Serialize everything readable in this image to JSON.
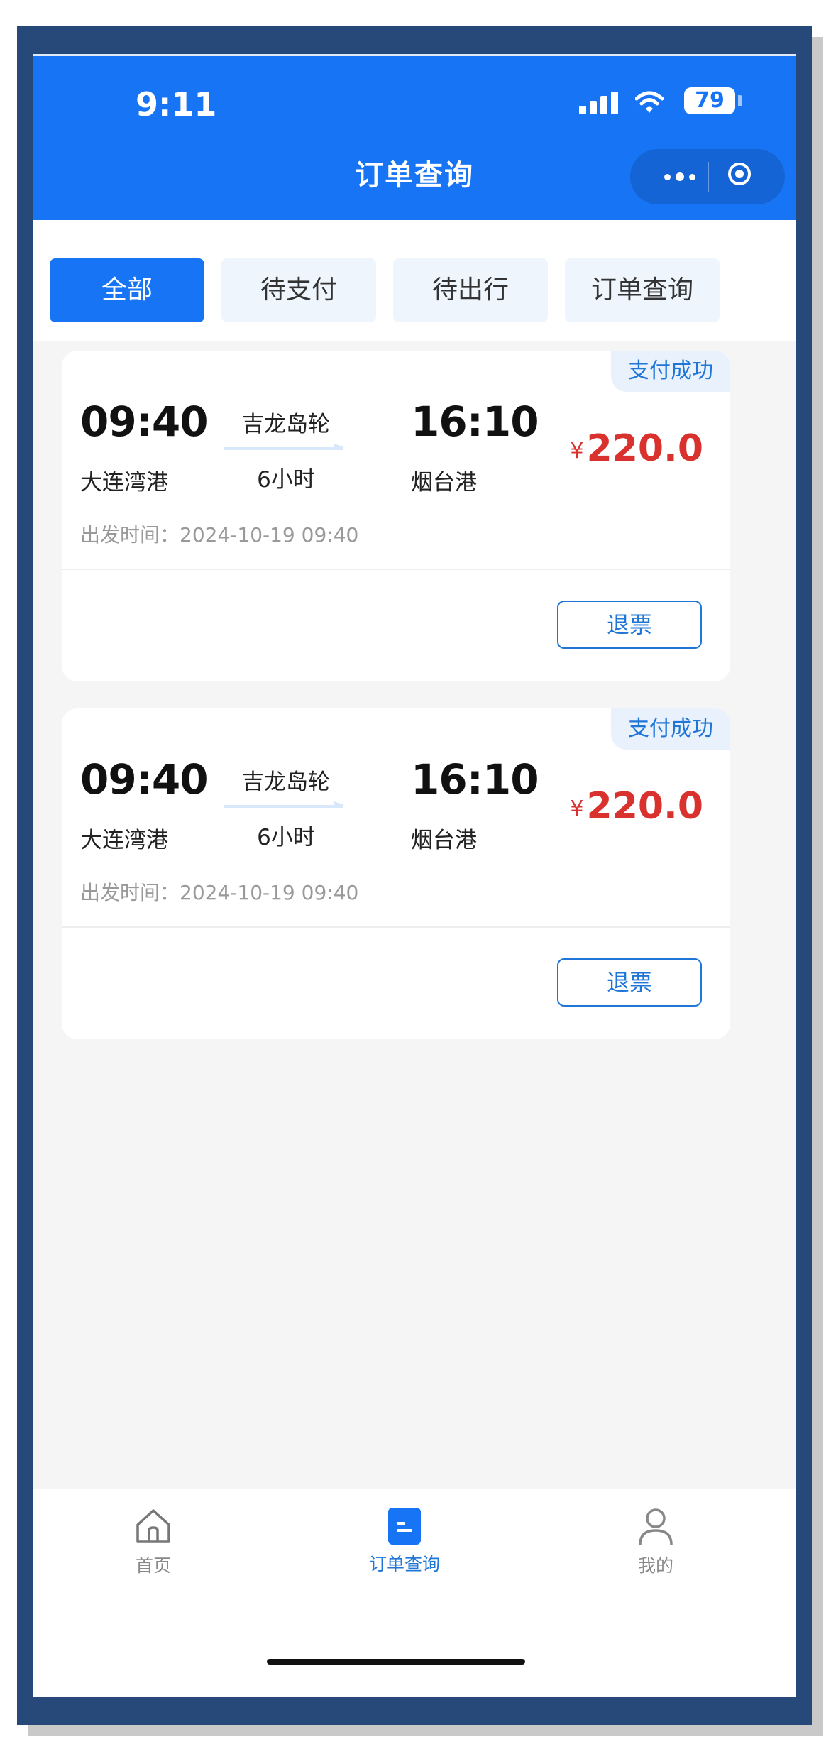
{
  "status_bar": {
    "time": "9:11",
    "battery": "79"
  },
  "header": {
    "title": "订单查询"
  },
  "tabs": [
    {
      "label": "全部",
      "active": true
    },
    {
      "label": "待支付",
      "active": false
    },
    {
      "label": "待出行",
      "active": false
    },
    {
      "label": "订单查询",
      "active": false
    }
  ],
  "orders": [
    {
      "status": "支付成功",
      "depart_time": "09:40",
      "depart_port": "大连湾港",
      "ship": "吉龙岛轮",
      "duration": "6小时",
      "arrive_time": "16:10",
      "arrive_port": "烟台港",
      "currency": "¥",
      "price": "220.0",
      "depart_label": "出发时间：",
      "depart_datetime": "2024-10-19 09:40",
      "action": "退票"
    },
    {
      "status": "支付成功",
      "depart_time": "09:40",
      "depart_port": "大连湾港",
      "ship": "吉龙岛轮",
      "duration": "6小时",
      "arrive_time": "16:10",
      "arrive_port": "烟台港",
      "currency": "¥",
      "price": "220.0",
      "depart_label": "出发时间：",
      "depart_datetime": "2024-10-19 09:40",
      "action": "退票"
    }
  ],
  "bottom_nav": [
    {
      "label": "首页",
      "icon": "home-icon",
      "active": false
    },
    {
      "label": "订单查询",
      "icon": "order-icon",
      "active": true
    },
    {
      "label": "我的",
      "icon": "profile-icon",
      "active": false
    }
  ],
  "colors": {
    "primary": "#1775f5",
    "price": "#d9322e",
    "status": "#1f76d6"
  }
}
